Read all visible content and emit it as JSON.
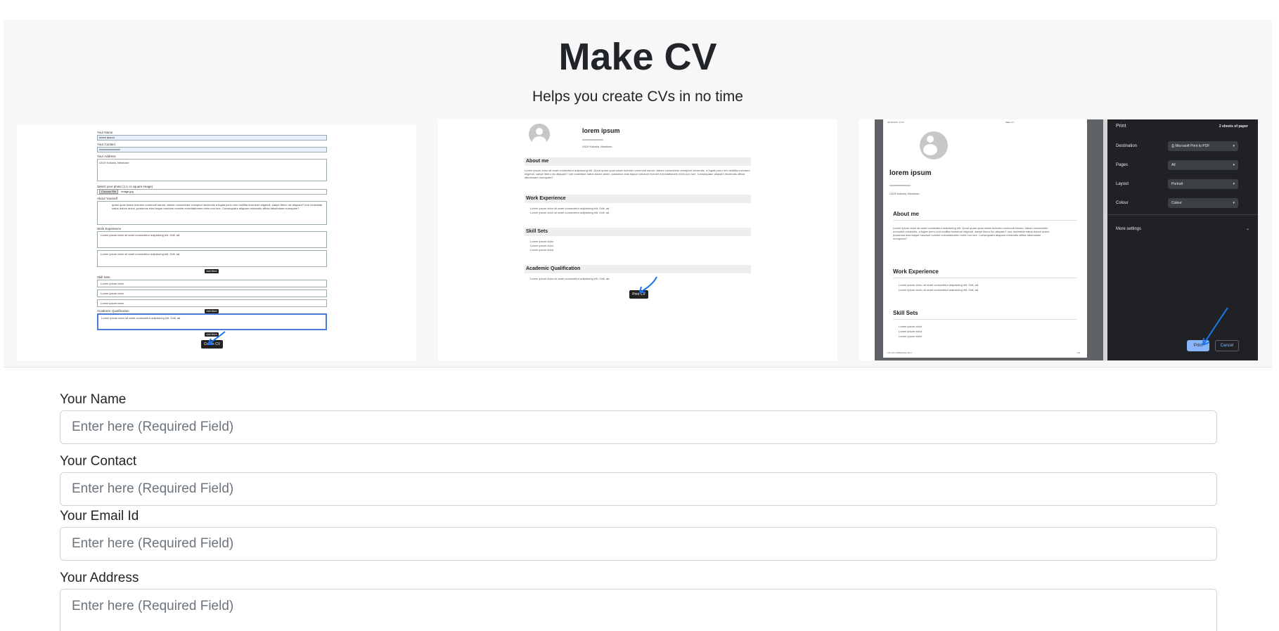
{
  "hero": {
    "title": "Make CV",
    "subtitle": "Helps you create CVs in no time"
  },
  "screenshot_form": {
    "labels": [
      "Your Name",
      "Your Contact",
      "Your Address",
      "Select your photo (1:1 or square image)",
      "About Yourself",
      "Work Experience",
      "Skill Sets",
      "Academic Qualification"
    ],
    "name_value": "lorem ipsum",
    "contact_value": "xxxxxxxxxxxxxxx",
    "address_value": "LB19 Kolkata, Newtown",
    "file_button": "Choose File",
    "file_name": "image.jpg",
    "about_text": "quam quos totam dolorem commodi earum, labore consectetur excepturi reiciendis a fugiat porro rem mollitia inventore eligendi, saepe libero hic aliquam? Iure molestiae natus dolore animi, possimus eius itaque nesciunt eveniet exercitationem enim non iure, Consequatur aliquam reiciendis officia laboriosam numquam?",
    "work_1": "Lorem ipsum dolor sit amet consectetur adipisicing elit. Odit, ad.",
    "work_2": "Lorem ipsum dolor sit amet consectetur adipisicing elit. Odit, ad.",
    "skill_1": "Lorem ipsum dolor",
    "skill_2": "Lorem ipsum dolor",
    "skill_3": "Lorem ipsum dolor",
    "academic_1": "Lorem ipsum dolor sit amet consectetur adipisicing elit. Odit, ad.",
    "add_more": "Add More",
    "create_button": "Create CV"
  },
  "screenshot_cv": {
    "name": "lorem ipsum",
    "contact": "xxxxxxxxxxxxxxx",
    "address": "LB19 Kolkata, Newtown",
    "sections": [
      "About me",
      "Work Experience",
      "Skill Sets",
      "Academic Qualification"
    ],
    "about_text": "Lorem ipsum dolor sit amet consectetur adipisicing elit. Quod quam quos totam dolorem commodi earum, labore consectetur excepturi reiciendis, a fugiat porro rem mollitia inventore eligendi, saepe libero hic aliquam? Iure molestiae natus dolore animi, possimus eius itaque nesciunt eveniet exercitationem enim non iure. Consequatur aliquam reiciendis officia laboriosam numquam?",
    "work_1": "Lorem ipsum dolor sit amet consectetur adipisicing elit. Odit, ad.",
    "work_2": "Lorem ipsum dolor sit amet consectetur adipisicing elit. Odit, ad.",
    "skill_1": "Lorem ipsum dolor",
    "skill_2": "Lorem ipsum dolor",
    "skill_3": "Lorem ipsum dolor",
    "academic_1": "Lorem ipsum dolor sit amet consectetur adipisicing elit. Odit, ad.",
    "print_button": "Print CV"
  },
  "screenshot_print": {
    "header_left": "04/11/2022, 23:11",
    "header_right": "Make CV",
    "name": "lorem ipsum",
    "contact": "xxxxxxxxxxxxxxx",
    "address": "LB19 Kolkata, Newtown",
    "sections": [
      "About me",
      "Work Experience",
      "Skill Sets"
    ],
    "about_text": "Lorem ipsum dolor sit amet consectetur adipisicing elit. Quod quam quos totam dolorem commodi earum, labore consectetur excepturi reiciendis, a fugiat porro rem mollitia inventore eligendi, saepe libero hic aliquam? Iure molestiae natus dolore animi, possimus eius itaque nesciunt eveniet exercitationem enim non iure. Consequatur aliquam reiciendis officia laboriosam numquam?",
    "work_1": "Lorem ipsum dolor, sit amet consectetur adipisicing elit. Odit, ad.",
    "work_2": "Lorem ipsum dolor, sit amet consectetur adipisicing elit. Odit, ad.",
    "skill_1": "Lorem ipsum dolor",
    "skill_2": "Lorem ipsum dolor",
    "skill_3": "Lorem ipsum dolor",
    "footer_left": "127.0.0.1:5500/index.html",
    "footer_right": "1/2",
    "panel_title": "Print",
    "sheets": "2 sheets of paper",
    "destination_label": "Destination",
    "destination_value": "Microsoft Print to PDF",
    "pages_label": "Pages",
    "pages_value": "All",
    "layout_label": "Layout",
    "layout_value": "Portrait",
    "colour_label": "Colour",
    "colour_value": "Colour",
    "more_settings": "More settings",
    "print_button": "Print",
    "cancel_button": "Cancel"
  },
  "form": {
    "name_label": "Your Name",
    "name_placeholder": "Enter here (Required Field)",
    "contact_label": "Your Contact",
    "contact_placeholder": "Enter here (Required Field)",
    "email_label": "Your Email Id",
    "email_placeholder": "Enter here (Required Field)",
    "address_label": "Your Address",
    "address_placeholder": "Enter here (Required Field)"
  },
  "colors": {
    "hero_bg": "#f7f7f7",
    "arrow_blue": "#1a73e8",
    "print_panel_bg": "#202124",
    "print_accent": "#8ab4f8"
  }
}
